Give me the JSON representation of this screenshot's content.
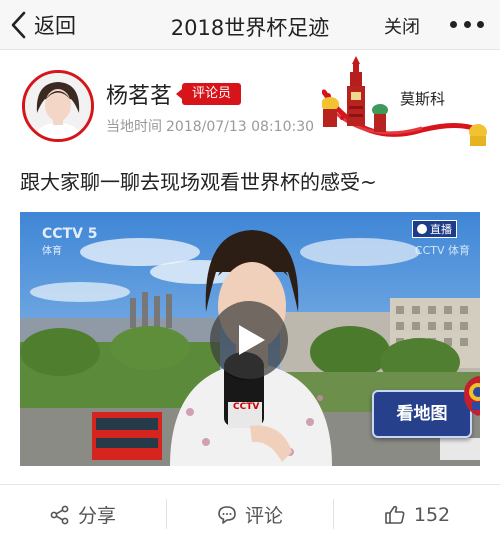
{
  "nav": {
    "back_label": "返回",
    "title": "2018世界杯足迹",
    "close_label": "关闭",
    "more_icon": "more-dots-icon"
  },
  "author": {
    "name": "杨茗茗",
    "role_badge": "评论员",
    "time_label": "当地时间",
    "time_value": "2018/07/13 08:10:30",
    "city": "莫斯科"
  },
  "post": {
    "text": "跟大家聊一聊去现场观看世界杯的感受~"
  },
  "video": {
    "channel_logo": "CCTV 5",
    "channel_sub": "体育",
    "live_badge": "直播",
    "watermark": "CCTV 体育",
    "map_button": "看地图",
    "mic_logo": "CCTV"
  },
  "actions": {
    "share_label": "分享",
    "comment_label": "评论",
    "like_count": "152"
  },
  "colors": {
    "accent_red": "#d7141a",
    "map_blue": "#27408b"
  }
}
